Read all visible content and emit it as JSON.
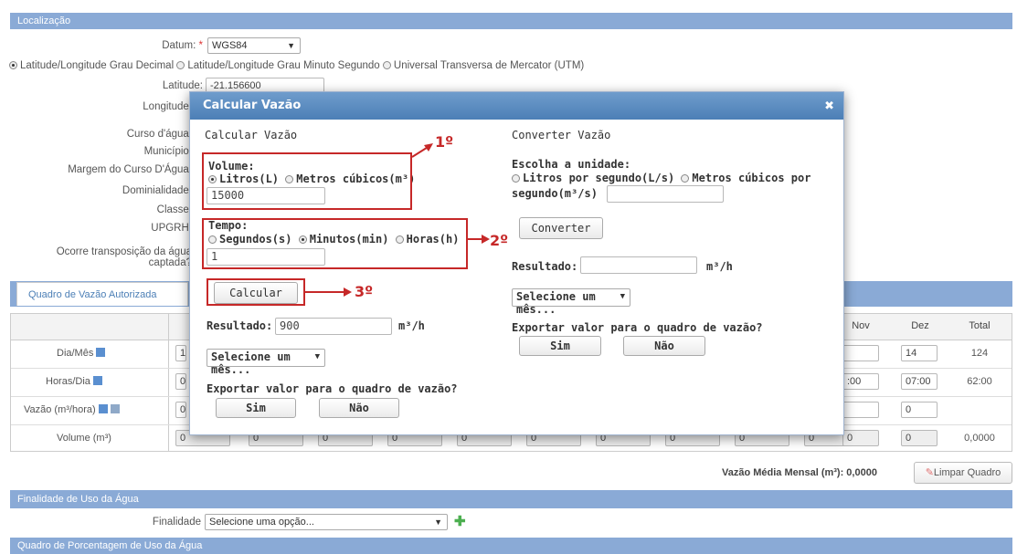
{
  "localizacao": {
    "section_title": "Localização",
    "datum_label": "Datum:",
    "datum_value": "WGS84",
    "radio_options": [
      "Latitude/Longitude Grau Decimal",
      "Latitude/Longitude Grau Minuto Segundo",
      "Universal Transversa de Mercator (UTM)"
    ],
    "latitude_label": "Latitude:",
    "latitude_value": "-21.156600",
    "longitude_label": "Longitude:",
    "fields": [
      "Curso d'água:",
      "Município:",
      "Margem do Curso D'Água:",
      "Dominialidade:",
      "Classe:",
      "UPGRH:"
    ],
    "transposicao_line1": "Ocorre transposição da água",
    "transposicao_line2": "captada?"
  },
  "quadro": {
    "tab_label": "Quadro de Vazão Autorizada",
    "col_nov": "Nov",
    "col_dez": "Dez",
    "col_total": "Total",
    "rows": [
      {
        "label": "Dia/Mês",
        "first": "12",
        "nov": "",
        "dez": "14",
        "total": "124"
      },
      {
        "label": "Horas/Dia",
        "first": "06",
        "nov": ":00",
        "dez": "07:00",
        "total": "62:00"
      },
      {
        "label": "Vazão (m³/hora)",
        "first": "0",
        "nov": "",
        "dez": "0",
        "total": ""
      },
      {
        "label": "Volume (m³)",
        "first": "0",
        "nov": "0",
        "dez": "0",
        "total": "0,0000"
      }
    ],
    "media_label": "Vazão Média Mensal (m³): 0,0000",
    "limpar_label": "Limpar Quadro"
  },
  "finalidade": {
    "section_title": "Finalidade de Uso da Água",
    "label": "Finalidade",
    "select_value": "Selecione uma opção..."
  },
  "porcentagem": {
    "section_title": "Quadro de Porcentagem de Uso da Água"
  },
  "modal": {
    "title": "Calcular Vazão",
    "left_heading": "Calcular Vazão",
    "volume_label": "Volume:",
    "vol_opt1": "Litros(L)",
    "vol_opt2": "Metros cúbicos(m³)",
    "volume_value": "15000",
    "tempo_label": "Tempo:",
    "tempo_opt1": "Segundos(s)",
    "tempo_opt2": "Minutos(min)",
    "tempo_opt3": "Horas(h)",
    "tempo_value": "1",
    "calcular_label": "Calcular",
    "resultado_label": "Resultado:",
    "resultado_value": "900",
    "unit": "m³/h",
    "mes_select": "Selecione um mês...",
    "exportar_label": "Exportar valor para o quadro de vazão?",
    "sim": "Sim",
    "nao": "Não",
    "right_heading": "Converter Vazão",
    "unidade_label": "Escolha a unidade:",
    "conv_opt1": "Litros por segundo(L/s)",
    "conv_opt2_a": "Metros cúbicos por",
    "conv_opt2_b": "segundo(m³/s)",
    "converter_label": "Converter",
    "resultado2_label": "Resultado:",
    "resultado2_value": "",
    "mes_select2": "Selecione um mês...",
    "exportar2_label": "Exportar valor para o quadro de vazão?",
    "sim2": "Sim",
    "nao2": "Não"
  },
  "annotations": {
    "a1": "1º",
    "a2": "2º",
    "a3": "3º"
  }
}
